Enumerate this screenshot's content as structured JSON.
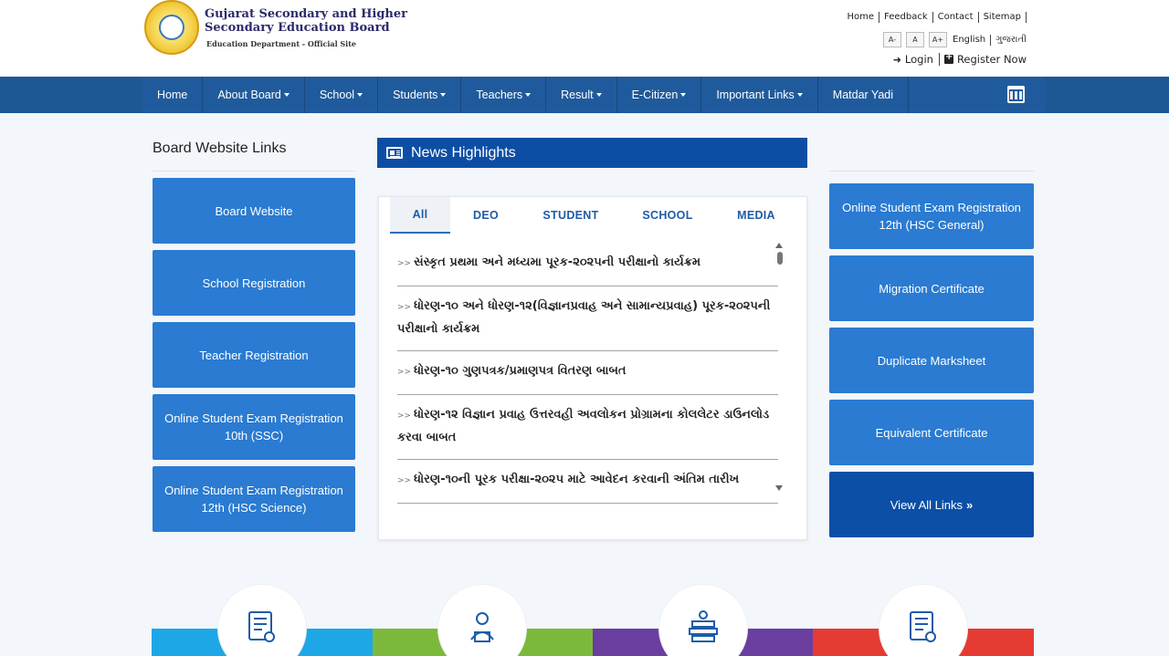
{
  "header": {
    "logo_title_line1": "Gujarat Secondary and Higher",
    "logo_title_line2": "Secondary Education Board",
    "logo_subtitle": "Education Department - Official Site",
    "top_links": [
      "Home",
      "Feedback",
      "Contact",
      "Sitemap"
    ],
    "font_buttons": [
      "A-",
      "A",
      "A+"
    ],
    "languages": [
      "English",
      "ગુજરાતી"
    ],
    "login_label": "Login",
    "register_label": "Register Now"
  },
  "nav": {
    "items": [
      {
        "label": "Home",
        "dropdown": false
      },
      {
        "label": "About Board",
        "dropdown": true
      },
      {
        "label": "School",
        "dropdown": true
      },
      {
        "label": "Students",
        "dropdown": true
      },
      {
        "label": "Teachers",
        "dropdown": true
      },
      {
        "label": "Result",
        "dropdown": true
      },
      {
        "label": "E-Citizen",
        "dropdown": true
      },
      {
        "label": "Important Links",
        "dropdown": true
      },
      {
        "label": "Matdar Yadi",
        "dropdown": false
      }
    ],
    "calendar_icon": "calendar-icon"
  },
  "left": {
    "title": "Board Website Links",
    "links": [
      "Board Website",
      "School Registration",
      "Teacher Registration",
      "Online Student Exam Registration 10th (SSC)",
      "Online Student Exam Registration 12th (HSC Science)"
    ]
  },
  "news": {
    "title": "News Highlights",
    "tabs": [
      "All",
      "DEO",
      "STUDENT",
      "SCHOOL",
      "MEDIA"
    ],
    "active_tab": "All",
    "items": [
      "સંસ્કૃત પ્રથમા અને મધ્યમા પૂરક-૨૦૨૫ની પરીક્ષાનો કાર્યક્રમ",
      "ધોરણ-૧૦ અને ધોરણ-૧૨(વિજ્ઞાનપ્રવાહ અને સામાન્યપ્રવાહ) પૂરક-૨૦૨૫ની પરીક્ષાનો કાર્યક્રમ",
      "ધોરણ-૧૦ ગુણપત્રક/પ્રમાણપત્ર વિતરણ બાબત",
      "ધોરણ-૧૨ વિજ્ઞાન પ્રવાહ ઉત્તરવહી અવલોકન પ્રોગ્રામના કોલલેટર ડાઉનલોડ કરવા બાબત",
      "ધોરણ-૧૦ની પૂરક પરીક્ષા-૨૦૨૫ માટે આવેદન કરવાની અંતિમ તારીખ"
    ],
    "bullet": ">>"
  },
  "right": {
    "links": [
      "Online Student Exam Registration 12th (HSC General)",
      "Migration Certificate",
      "Duplicate Marksheet",
      "Equivalent Certificate"
    ],
    "view_all": "View All Links"
  },
  "colors": {
    "nav_bg": "#1f5b9c",
    "link_btn": "#2a7bd1",
    "view_all_btn": "#0b4fa6",
    "stripe": [
      "#1ea7e6",
      "#7cb83c",
      "#6a3fa0",
      "#e53b33"
    ]
  },
  "bottom_icons": [
    "certificate-icon",
    "student-icon",
    "teacher-desk-icon",
    "certificate-icon"
  ]
}
